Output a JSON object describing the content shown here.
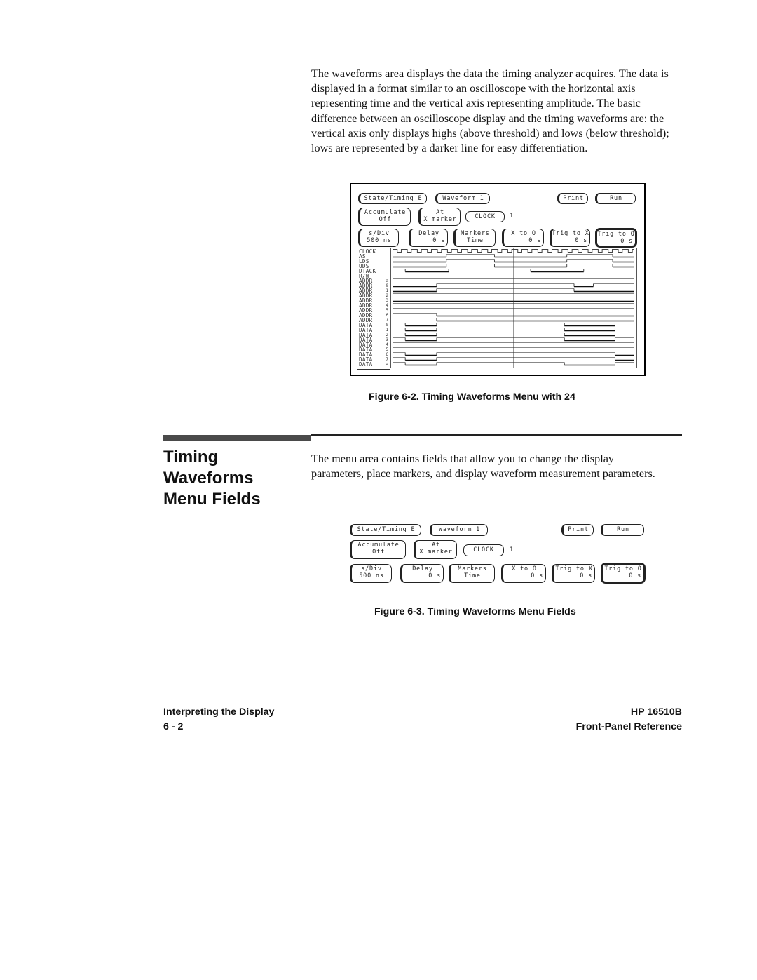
{
  "intro_paragraph": "The waveforms area displays the data the timing analyzer acquires. The data is displayed in a format similar to an oscilloscope with the horizontal axis representing time and the vertical axis representing amplitude. The basic difference between an oscilloscope display and the timing waveforms are: the vertical axis only displays highs (above threshold) and lows (below threshold); lows are represented by a darker line for easy differentiation.",
  "menu": {
    "state_timing": "State/Timing E",
    "waveform": "Waveform 1",
    "print": "Print",
    "run": "Run",
    "accumulate_label": "Accumulate",
    "accumulate_value": "Off",
    "at_label": "At",
    "at_value": "X marker",
    "clock": "CLOCK",
    "clock_value": "1",
    "sdiv_label": "s/Div",
    "sdiv_value": "500 ns",
    "delay_label": "Delay",
    "delay_value": "0   s",
    "markers_label": "Markers",
    "markers_value": "Time",
    "x_to_o_label": "X to O",
    "x_to_o_value": "0   s",
    "trig_to_x_label": "Trig to X",
    "trig_to_x_value": "0   s",
    "trig_to_o_label": "Trig to O",
    "trig_to_o_value": "0   s"
  },
  "waveform_labels": [
    {
      "name": "CLOCK",
      "idx": ""
    },
    {
      "name": "AS",
      "idx": ""
    },
    {
      "name": "LDS",
      "idx": ""
    },
    {
      "name": "UDS",
      "idx": ""
    },
    {
      "name": "DTACK",
      "idx": ""
    },
    {
      "name": "R/W",
      "idx": ""
    },
    {
      "name": "ADDR",
      "idx": "a"
    },
    {
      "name": "ADDR",
      "idx": "0"
    },
    {
      "name": "ADDR",
      "idx": "1"
    },
    {
      "name": "ADDR",
      "idx": "2"
    },
    {
      "name": "ADDR",
      "idx": "3"
    },
    {
      "name": "ADDR",
      "idx": "4"
    },
    {
      "name": "ADDR",
      "idx": "5"
    },
    {
      "name": "ADDR",
      "idx": "6"
    },
    {
      "name": "ADDR",
      "idx": "7"
    },
    {
      "name": "DATA",
      "idx": "0"
    },
    {
      "name": "DATA",
      "idx": "1"
    },
    {
      "name": "DATA",
      "idx": "2"
    },
    {
      "name": "DATA",
      "idx": "3"
    },
    {
      "name": "DATA",
      "idx": "4"
    },
    {
      "name": "DATA",
      "idx": "5"
    },
    {
      "name": "DATA",
      "idx": "6"
    },
    {
      "name": "DATA",
      "idx": "7"
    },
    {
      "name": "DATA",
      "idx": "a"
    }
  ],
  "waveforms": [
    {
      "type": "clock"
    },
    {
      "hl": [
        [
          0,
          0
        ],
        [
          0.22,
          1
        ],
        [
          0.42,
          0
        ],
        [
          0.72,
          1
        ],
        [
          0.91,
          0
        ]
      ]
    },
    {
      "hl": [
        [
          0,
          0
        ],
        [
          0.22,
          1
        ],
        [
          0.42,
          0
        ],
        [
          0.72,
          1
        ],
        [
          0.91,
          0
        ]
      ]
    },
    {
      "hl": [
        [
          0,
          0
        ],
        [
          0.22,
          1
        ],
        [
          0.42,
          0
        ],
        [
          0.72,
          1
        ],
        [
          0.91,
          0
        ]
      ]
    },
    {
      "hl": [
        [
          0,
          1
        ],
        [
          0.05,
          0
        ],
        [
          0.23,
          1
        ],
        [
          0.57,
          0
        ],
        [
          0.79,
          1
        ]
      ]
    },
    {
      "hl": [
        [
          0,
          1
        ]
      ]
    },
    {
      "hl": [
        [
          0,
          1
        ]
      ]
    },
    {
      "hl": [
        [
          0,
          0
        ],
        [
          0.18,
          1
        ],
        [
          0.75,
          0
        ],
        [
          0.83,
          1
        ]
      ]
    },
    {
      "hl": [
        [
          0,
          0
        ],
        [
          0.18,
          1
        ],
        [
          0.75,
          0
        ]
      ]
    },
    {
      "hl": [
        [
          0,
          1
        ]
      ]
    },
    {
      "hl": [
        [
          0,
          0
        ]
      ]
    },
    {
      "hl": [
        [
          0,
          1
        ]
      ]
    },
    {
      "hl": [
        [
          0,
          1
        ]
      ]
    },
    {
      "hl": [
        [
          0,
          1
        ],
        [
          0.18,
          0
        ]
      ]
    },
    {
      "hl": [
        [
          0,
          1
        ],
        [
          0.18,
          0
        ]
      ]
    },
    {
      "hl": [
        [
          0,
          1
        ],
        [
          0.05,
          0
        ],
        [
          0.18,
          1
        ],
        [
          0.71,
          0
        ],
        [
          0.92,
          1
        ]
      ]
    },
    {
      "hl": [
        [
          0,
          1
        ],
        [
          0.05,
          0
        ],
        [
          0.18,
          1
        ],
        [
          0.71,
          0
        ],
        [
          0.92,
          1
        ]
      ]
    },
    {
      "hl": [
        [
          0,
          1
        ],
        [
          0.05,
          0
        ],
        [
          0.18,
          1
        ],
        [
          0.71,
          0
        ],
        [
          0.92,
          1
        ]
      ]
    },
    {
      "hl": [
        [
          0,
          1
        ],
        [
          0.05,
          0
        ],
        [
          0.18,
          1
        ],
        [
          0.71,
          0
        ],
        [
          0.92,
          1
        ]
      ]
    },
    {
      "hl": [
        [
          0,
          1
        ]
      ]
    },
    {
      "hl": [
        [
          0,
          1
        ]
      ]
    },
    {
      "hl": [
        [
          0,
          1
        ],
        [
          0.05,
          0
        ],
        [
          0.18,
          1
        ],
        [
          0.92,
          0
        ]
      ]
    },
    {
      "hl": [
        [
          0,
          1
        ],
        [
          0.05,
          0
        ],
        [
          0.18,
          1
        ],
        [
          0.92,
          0
        ]
      ]
    },
    {
      "hl": [
        [
          0,
          1
        ],
        [
          0.05,
          0
        ],
        [
          0.18,
          1
        ],
        [
          0.71,
          0
        ],
        [
          0.92,
          1
        ]
      ]
    }
  ],
  "x_marker_position": 0.5,
  "figure1_caption": "Figure 6-2. Timing Waveforms Menu with 24",
  "section_title_lines": [
    "Timing",
    "Waveforms",
    "Menu Fields"
  ],
  "section_body": "The menu area contains fields that allow you to change the display parameters, place markers, and display waveform measurement parameters.",
  "figure2_caption": "Figure 6-3. Timing Waveforms Menu Fields",
  "footer": {
    "left_title": "Interpreting the Display",
    "page_number": "6 - 2",
    "right_product": "HP 16510B",
    "right_manual": "Front-Panel Reference"
  }
}
